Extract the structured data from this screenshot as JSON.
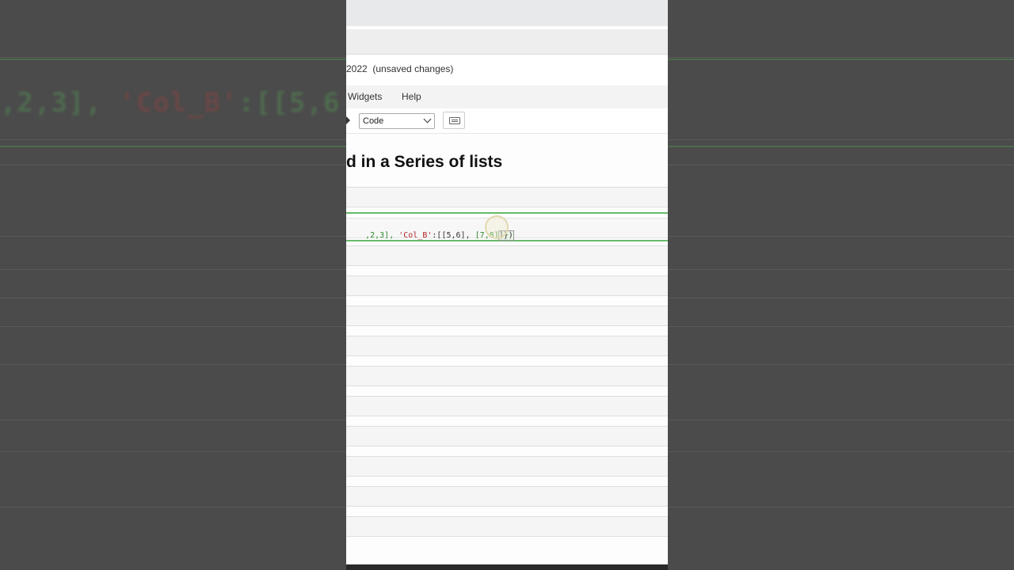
{
  "notebook": {
    "save_status": "2022  (unsaved changes)",
    "menu": [
      "Widgets",
      "Help"
    ],
    "toolbar": {
      "cell_type": "Code",
      "keyboard_icon": "keyboard-icon"
    },
    "heading": "d in a Series of lists",
    "code": {
      "p1": ",2,3], ",
      "p2": "'Col_B'",
      "p3": ":[[5,6], ",
      "p4": "[7,8]",
      "p5": "]})"
    }
  },
  "background": {
    "zoom_code": {
      "a": ",2,3], ",
      "b": "'Col_B'",
      "c": ":[[5,6"
    }
  },
  "colors": {
    "active_cell_border": "#66bb6a",
    "string": "#b22222",
    "number": "#2e8b2e"
  }
}
